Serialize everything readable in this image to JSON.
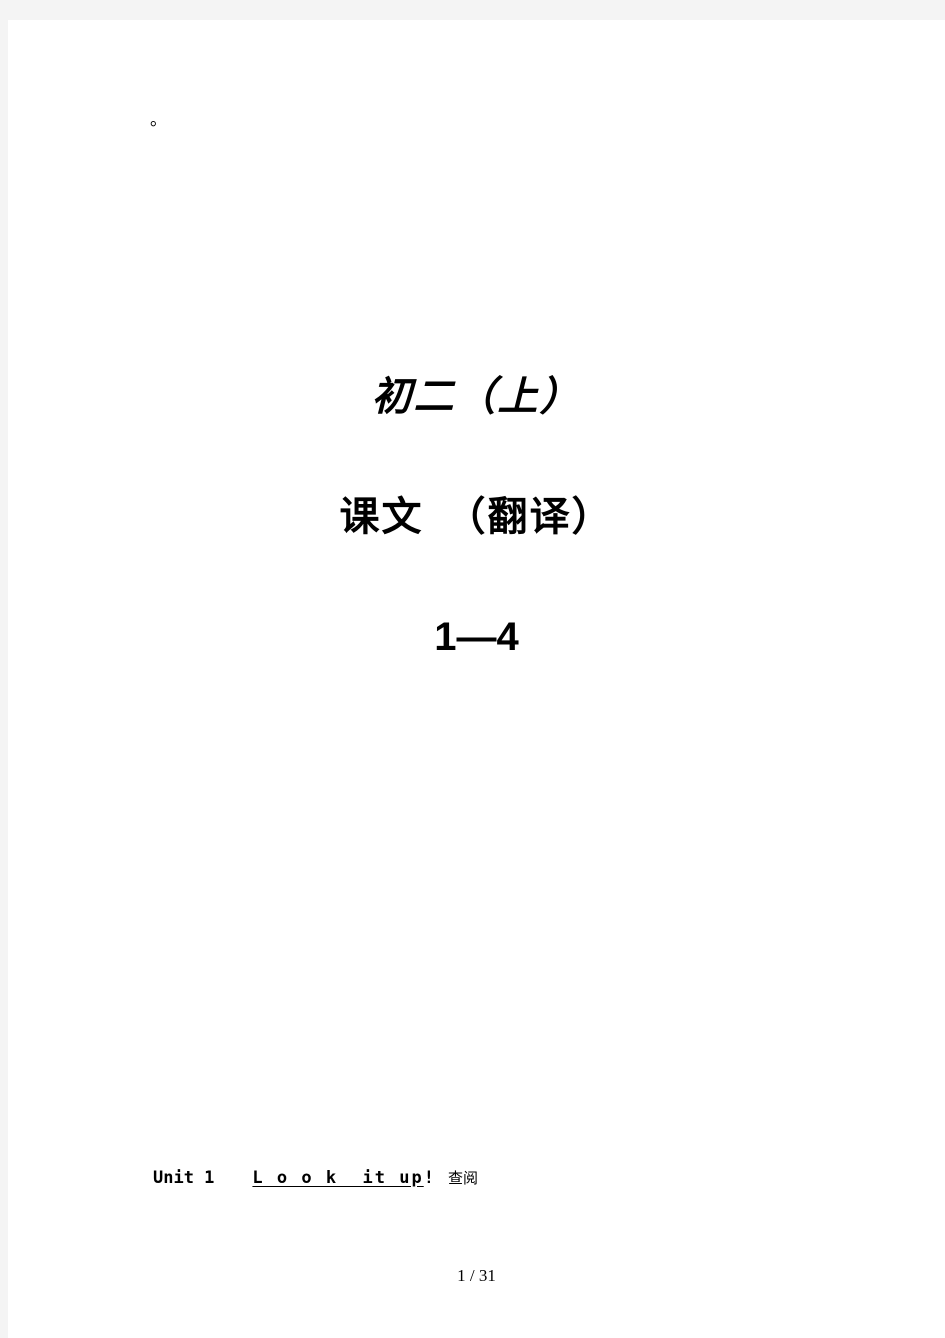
{
  "page": {
    "background_color": "#f4f4f4",
    "sheet_color": "#ffffff",
    "text_color": "#000000"
  },
  "top_mark": {
    "text": "。"
  },
  "title": {
    "grade": "初二（上）",
    "subject": "课文　（翻译）",
    "range": "1—4"
  },
  "unit_heading": {
    "unit_label": "Unit 1",
    "phrase": "L o o k  it up",
    "exclamation": "!",
    "gloss": "查阅"
  },
  "footer": {
    "page_number": "1 / 31"
  }
}
